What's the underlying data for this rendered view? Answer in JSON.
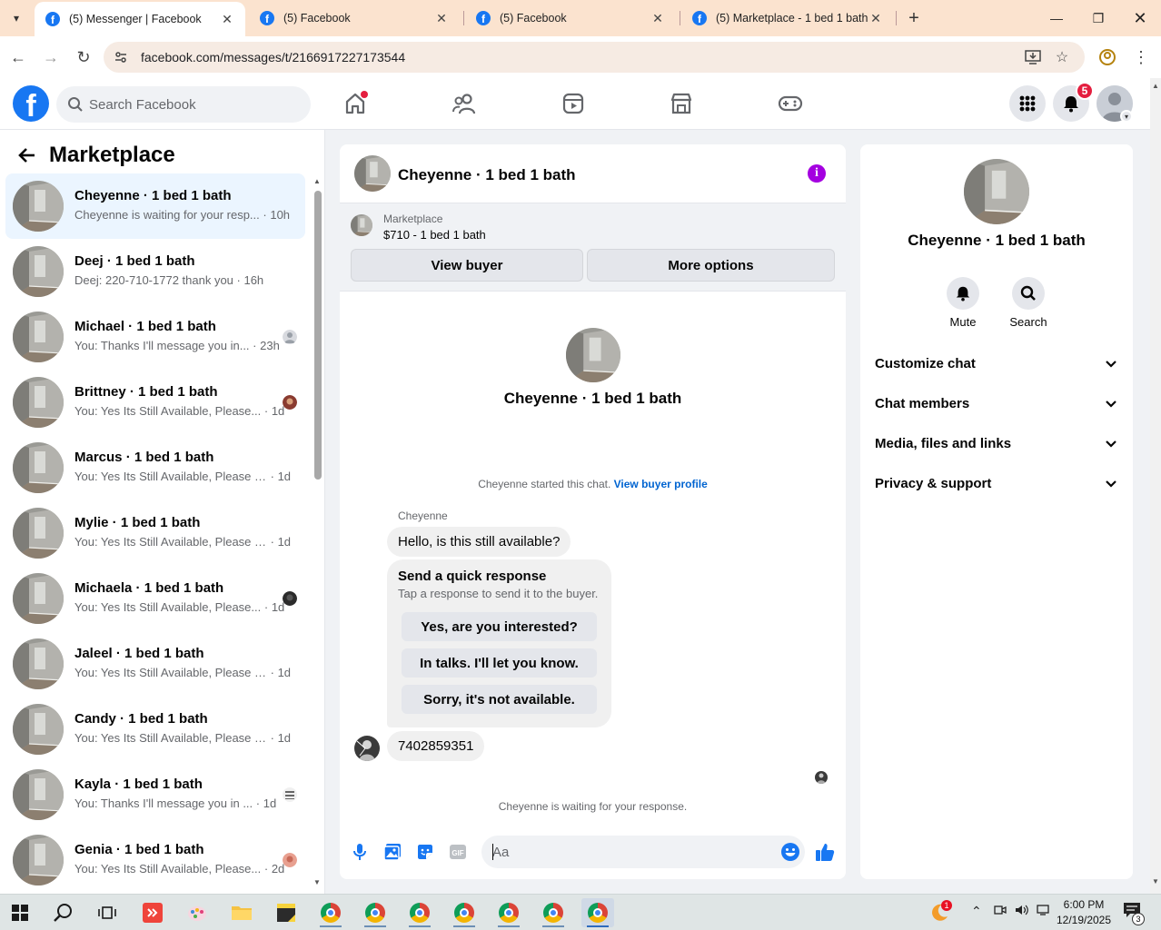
{
  "browser": {
    "tabs": [
      {
        "title": "(5) Messenger | Facebook",
        "active": true
      },
      {
        "title": "(5) Facebook",
        "active": false
      },
      {
        "title": "(5) Facebook",
        "active": false
      },
      {
        "title": "(5) Marketplace - 1 bed 1 bath",
        "active": false
      }
    ],
    "url": "facebook.com/messages/t/2166917227173544"
  },
  "fb": {
    "search_placeholder": "Search Facebook",
    "notifications_count": "5"
  },
  "left": {
    "title": "Marketplace",
    "conversations": [
      {
        "name": "Cheyenne · 1 bed 1 bath",
        "preview": "Cheyenne is waiting for your resp...",
        "time": "10h",
        "active": true
      },
      {
        "name": "Deej · 1 bed 1 bath",
        "preview": "Deej: 220-710-1772 thank you",
        "time": "16h"
      },
      {
        "name": "Michael · 1 bed 1 bath",
        "preview": "You: Thanks I'll message you in...",
        "time": "23h"
      },
      {
        "name": "Brittney · 1 bed 1 bath",
        "preview": "You: Yes Its Still Available, Please...",
        "time": "1d"
      },
      {
        "name": "Marcus · 1 bed 1 bath",
        "preview": "You: Yes Its Still Available, Please Se...",
        "time": "1d"
      },
      {
        "name": "Mylie · 1 bed 1 bath",
        "preview": "You: Yes Its Still Available, Please Se...",
        "time": "1d"
      },
      {
        "name": "Michaela · 1 bed 1 bath",
        "preview": "You: Yes Its Still Available, Please...",
        "time": "1d"
      },
      {
        "name": "Jaleel · 1 bed 1 bath",
        "preview": "You: Yes Its Still Available, Please Se...",
        "time": "1d"
      },
      {
        "name": "Candy · 1 bed 1 bath",
        "preview": "You: Yes Its Still Available, Please Se...",
        "time": "1d"
      },
      {
        "name": "Kayla · 1 bed 1 bath",
        "preview": "You: Thanks I'll message you in ...",
        "time": "1d"
      },
      {
        "name": "Genia · 1 bed 1 bath",
        "preview": "You: Yes Its Still Available, Please...",
        "time": "2d"
      }
    ]
  },
  "chat": {
    "name": "Cheyenne · 1 bed 1 bath",
    "marketplace_label": "Marketplace",
    "listing": "$710 - 1 bed 1 bath",
    "view_buyer": "View buyer",
    "more_options": "More options",
    "started_text": "Cheyenne started this chat.",
    "view_buyer_profile": "View buyer profile",
    "sender": "Cheyenne",
    "message1": "Hello, is this still available?",
    "quick_title": "Send a quick response",
    "quick_sub": "Tap a response to send it to the buyer.",
    "quick_replies": [
      "Yes, are you interested?",
      "In talks. I'll let you know.",
      "Sorry, it's not available."
    ],
    "message2": "7402859351",
    "waiting": "Cheyenne is waiting for your response.",
    "composer_placeholder": "Aa"
  },
  "right": {
    "name": "Cheyenne · 1 bed 1 bath",
    "mute": "Mute",
    "search": "Search",
    "sections": [
      "Customize chat",
      "Chat members",
      "Media, files and links",
      "Privacy & support"
    ]
  },
  "taskbar": {
    "time": "6:00 PM",
    "date": "12/19/2025",
    "weather_badge": "1",
    "notif_count": "3"
  },
  "colors": {
    "fb_blue": "#1877f2",
    "messenger_purple": "#a400e0",
    "active_conv": "#ebf5ff",
    "badge_red": "#e41e3f",
    "link": "#0064d1"
  }
}
